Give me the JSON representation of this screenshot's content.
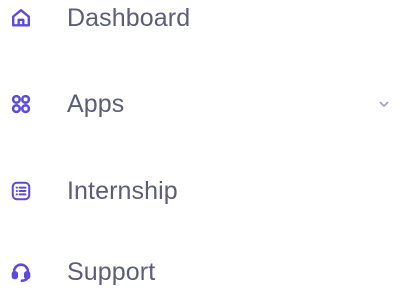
{
  "menu": {
    "items": [
      {
        "label": "Dashboard",
        "icon": "home-icon",
        "has_submenu": false
      },
      {
        "label": "Apps",
        "icon": "apps-grid-icon",
        "has_submenu": true
      },
      {
        "label": "Internship",
        "icon": "list-icon",
        "has_submenu": false
      },
      {
        "label": "Support",
        "icon": "headset-icon",
        "has_submenu": false
      }
    ]
  },
  "colors": {
    "icon_accent": "#5b4bdb",
    "label_text": "#5a5e78",
    "chevron": "#a3a8bd",
    "background": "#ffffff"
  }
}
